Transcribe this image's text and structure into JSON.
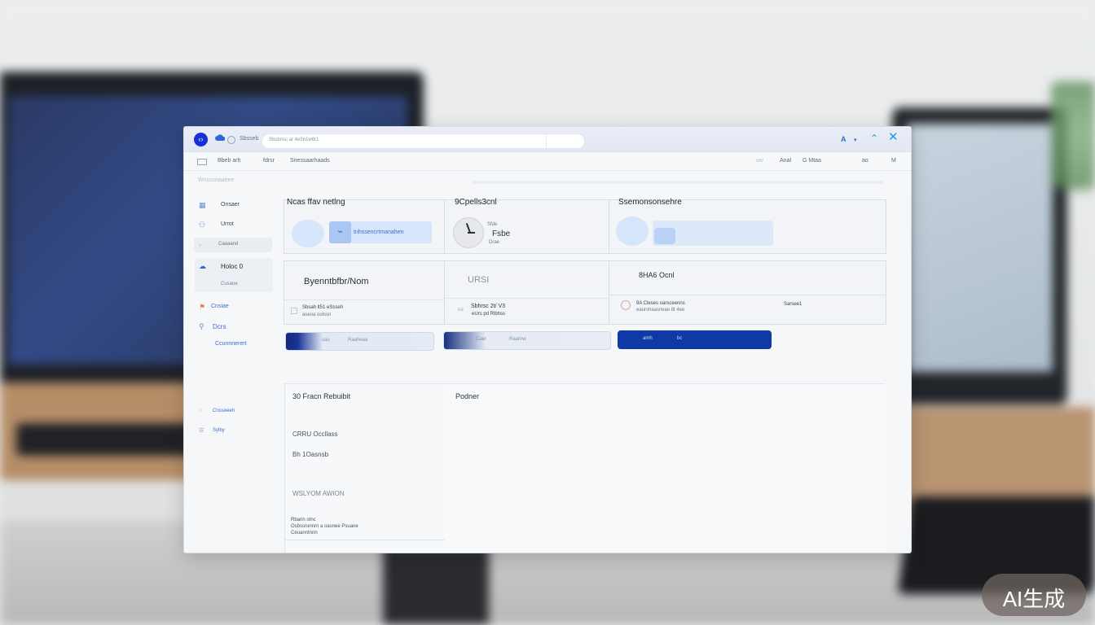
{
  "titlebar": {
    "app_name": "Sbsseb",
    "address": "Sbsbnsc ar 4e5h1w6t1",
    "right_icon_label": "A"
  },
  "menubar": [
    "Bbeb arh",
    "fdrsr",
    "Snessaarhaads"
  ],
  "menubar_right": [
    "ow",
    "Anal",
    "G Mtaa",
    "ao",
    "M"
  ],
  "breadcrumb": "Wnsscnaaeee",
  "sidebar": {
    "items": [
      {
        "label": "Onsaer"
      },
      {
        "label": "Urrot"
      },
      {
        "label": "Caaaand"
      },
      {
        "label": "Holoc 0"
      },
      {
        "label": "Cusaoe"
      },
      {
        "label": "Cnsiae"
      },
      {
        "label": "Dcrs"
      },
      {
        "label": "Ccunnnerert"
      }
    ],
    "footer_items": [
      {
        "label": "Cnsseeeh"
      },
      {
        "label": "Sylby"
      }
    ]
  },
  "cards_top": [
    {
      "title": "Ncas ffav netlng",
      "pill_text": "tnhssencrtmanahen"
    },
    {
      "title": "9Cpells3cnl",
      "line1": "Sfde",
      "line2": "Fsbe",
      "line3": "Drae"
    },
    {
      "title": "Ssemonsonsehre"
    }
  ],
  "cards_mid": [
    {
      "title": "Byenntbfbr/Nom",
      "sub1": "Sbsah lt51 eSsseh",
      "sub2": "aseoa oolssn"
    },
    {
      "title": "URSI",
      "sub1": "Sbhrsc 2t/ V3",
      "sub2": "eUrs pd Rlbhss",
      "left_mark": "ea"
    },
    {
      "title": "8HA6 Ocnl",
      "sub1": "9A Cleses oarsceenns",
      "sub2": "eaurshaasrwae 8t 4ee",
      "right_text": "Sarsee1"
    }
  ],
  "buttons": [
    {
      "label": "sau",
      "label2": "Raaheaa"
    },
    {
      "label": "Caer",
      "label2": "Raarnw"
    },
    {
      "label": "amh",
      "label2": "bc"
    }
  ],
  "panel_left": {
    "title": "30 Fracn Rebuibit",
    "line1": "CRRU Occllass",
    "line2": "Bh 1Oasnsb",
    "line3": "WSLYOM AWION",
    "foot1": "Rbarin otnc",
    "foot2": "Osbssronnrn a oasnee Psuane",
    "foot3": "Ceuanntnnn"
  },
  "panel_right": {
    "title": "Podner"
  },
  "watermark": "AI生成",
  "colors": {
    "accent": "#1831d6",
    "primary_button": "#0f3aa6",
    "link": "#2a6fd6"
  }
}
